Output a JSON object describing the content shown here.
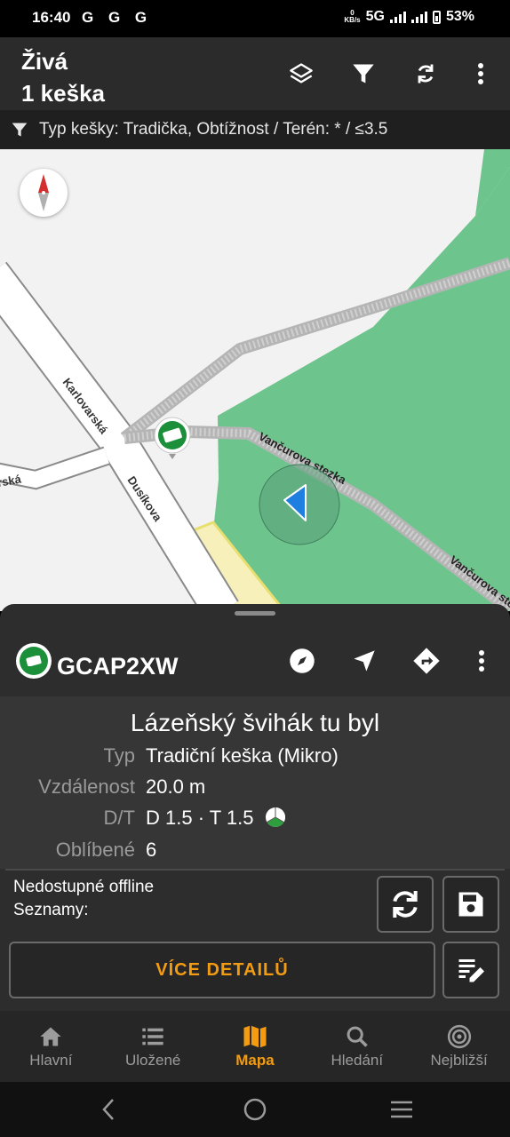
{
  "status_bar": {
    "time": "16:40",
    "notification_icons": "G G G",
    "net_speed_top": "0",
    "net_speed_unit": "KB/s",
    "network": "5G",
    "battery": "53%"
  },
  "app_bar": {
    "title": "Živá",
    "subtitle": "1 keška",
    "actions": [
      "layers-icon",
      "filter-icon",
      "refresh-icon",
      "more-vert-icon"
    ]
  },
  "filter_bar": {
    "text": "Typ kešky: Tradička, Obtížnost / Terén: * / ≤3.5"
  },
  "map": {
    "streets": [
      "Karlovarská",
      "Dusíkova",
      "rská",
      "Vančurova stezka",
      "Vančurova ste"
    ]
  },
  "cache": {
    "code": "GCAP2XW",
    "name": "Lázeňský švihák tu byl",
    "rows": [
      {
        "key": "Typ",
        "value": "Tradiční keška (Mikro)"
      },
      {
        "key": "Vzdálenost",
        "value": "20.0 m"
      },
      {
        "key": "D/T",
        "value": "D 1.5 · T 1.5"
      },
      {
        "key": "Oblíbené",
        "value": "6"
      }
    ],
    "offline_line1": "Nedostupné offline",
    "offline_line2": "Seznamy:",
    "more_details": "VÍCE DETAILŮ"
  },
  "bottom_nav": [
    {
      "label": "Hlavní",
      "icon": "home-icon"
    },
    {
      "label": "Uložené",
      "icon": "list-icon"
    },
    {
      "label": "Mapa",
      "icon": "map-icon",
      "active": true
    },
    {
      "label": "Hledání",
      "icon": "search-icon"
    },
    {
      "label": "Nejbližší",
      "icon": "nearby-icon"
    }
  ],
  "colors": {
    "accent": "#f39c12",
    "forest": "#6dc48d",
    "cache_green": "#1b8f3a",
    "location_blue": "#1f7fe0"
  }
}
